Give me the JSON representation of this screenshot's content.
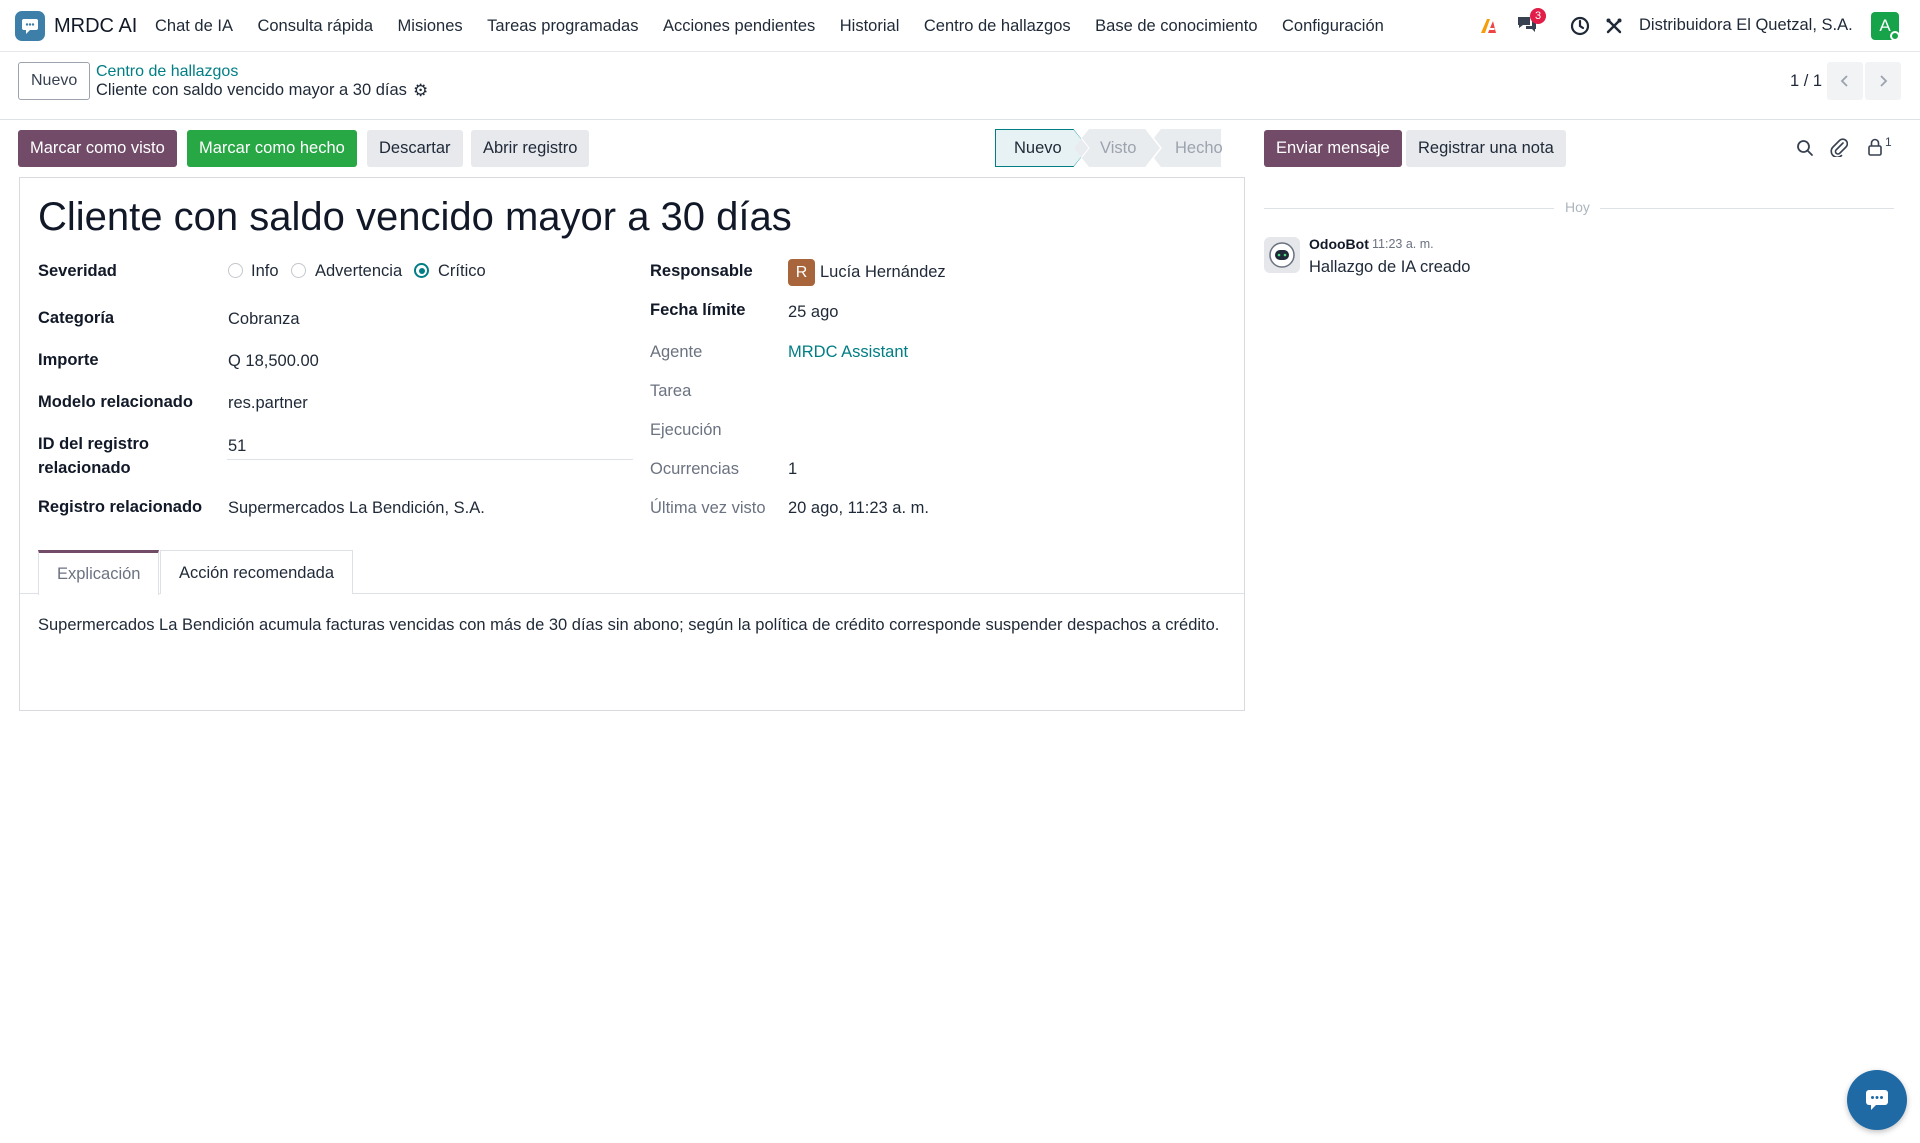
{
  "app": {
    "name": "MRDC AI"
  },
  "menu": [
    "Chat de IA",
    "Consulta rápida",
    "Misiones",
    "Tareas programadas",
    "Acciones pendientes",
    "Historial",
    "Centro de hallazgos",
    "Base de conocimiento",
    "Configuración"
  ],
  "systray": {
    "messages_badge": "3",
    "company": "Distribuidora El Quetzal, S.A.",
    "user_initial": "A"
  },
  "control": {
    "new_label": "Nuevo",
    "breadcrumb_parent": "Centro de hallazgos",
    "breadcrumb_current": "Cliente con saldo vencido mayor a 30 días",
    "pager": "1 / 1"
  },
  "actions": {
    "mark_seen": "Marcar como visto",
    "mark_done": "Marcar como hecho",
    "discard": "Descartar",
    "open_record": "Abrir registro"
  },
  "stages": {
    "items": [
      "Nuevo",
      "Visto",
      "Hecho"
    ],
    "current": "Nuevo"
  },
  "form": {
    "title": "Cliente con saldo vencido mayor a 30 días",
    "severity": {
      "label": "Severidad",
      "options": [
        "Info",
        "Advertencia",
        "Crítico"
      ],
      "selected": "Crítico"
    },
    "category": {
      "label": "Categoría",
      "value": "Cobranza"
    },
    "amount": {
      "label": "Importe",
      "value": "Q 18,500.00"
    },
    "related_model": {
      "label": "Modelo relacionado",
      "value": "res.partner"
    },
    "related_id": {
      "label_line1": "ID del registro",
      "label_line2": "relacionado",
      "value": "51"
    },
    "related_record": {
      "label": "Registro relacionado",
      "value": "Supermercados La Bendición, S.A."
    },
    "responsible": {
      "label": "Responsable",
      "initial": "R",
      "value": "Lucía Hernández"
    },
    "deadline": {
      "label": "Fecha límite",
      "value": "25 ago"
    },
    "agent": {
      "label": "Agente",
      "value": "MRDC Assistant"
    },
    "task": {
      "label": "Tarea",
      "value": ""
    },
    "execution": {
      "label": "Ejecución",
      "value": ""
    },
    "occurrences": {
      "label": "Ocurrencias",
      "value": "1"
    },
    "last_seen": {
      "label": "Última vez visto",
      "value": "20 ago, 11:23 a. m."
    }
  },
  "tabs": {
    "explanation": "Explicación",
    "recommended": "Acción recomendada",
    "explanation_text": "Supermercados La Bendición acumula facturas vencidas con más de 30 días sin abono; según la política de crédito corresponde suspender despachos a crédito."
  },
  "chatter": {
    "send_message": "Enviar mensaje",
    "log_note": "Registrar una nota",
    "followers_count": "1",
    "date_separator": "Hoy",
    "messages": [
      {
        "author": "OdooBot",
        "time": "11:23 a. m.",
        "body": "Hallazgo de IA creado"
      }
    ]
  },
  "colors": {
    "primary": "#714b67",
    "success": "#28a745",
    "link": "#017e84"
  }
}
